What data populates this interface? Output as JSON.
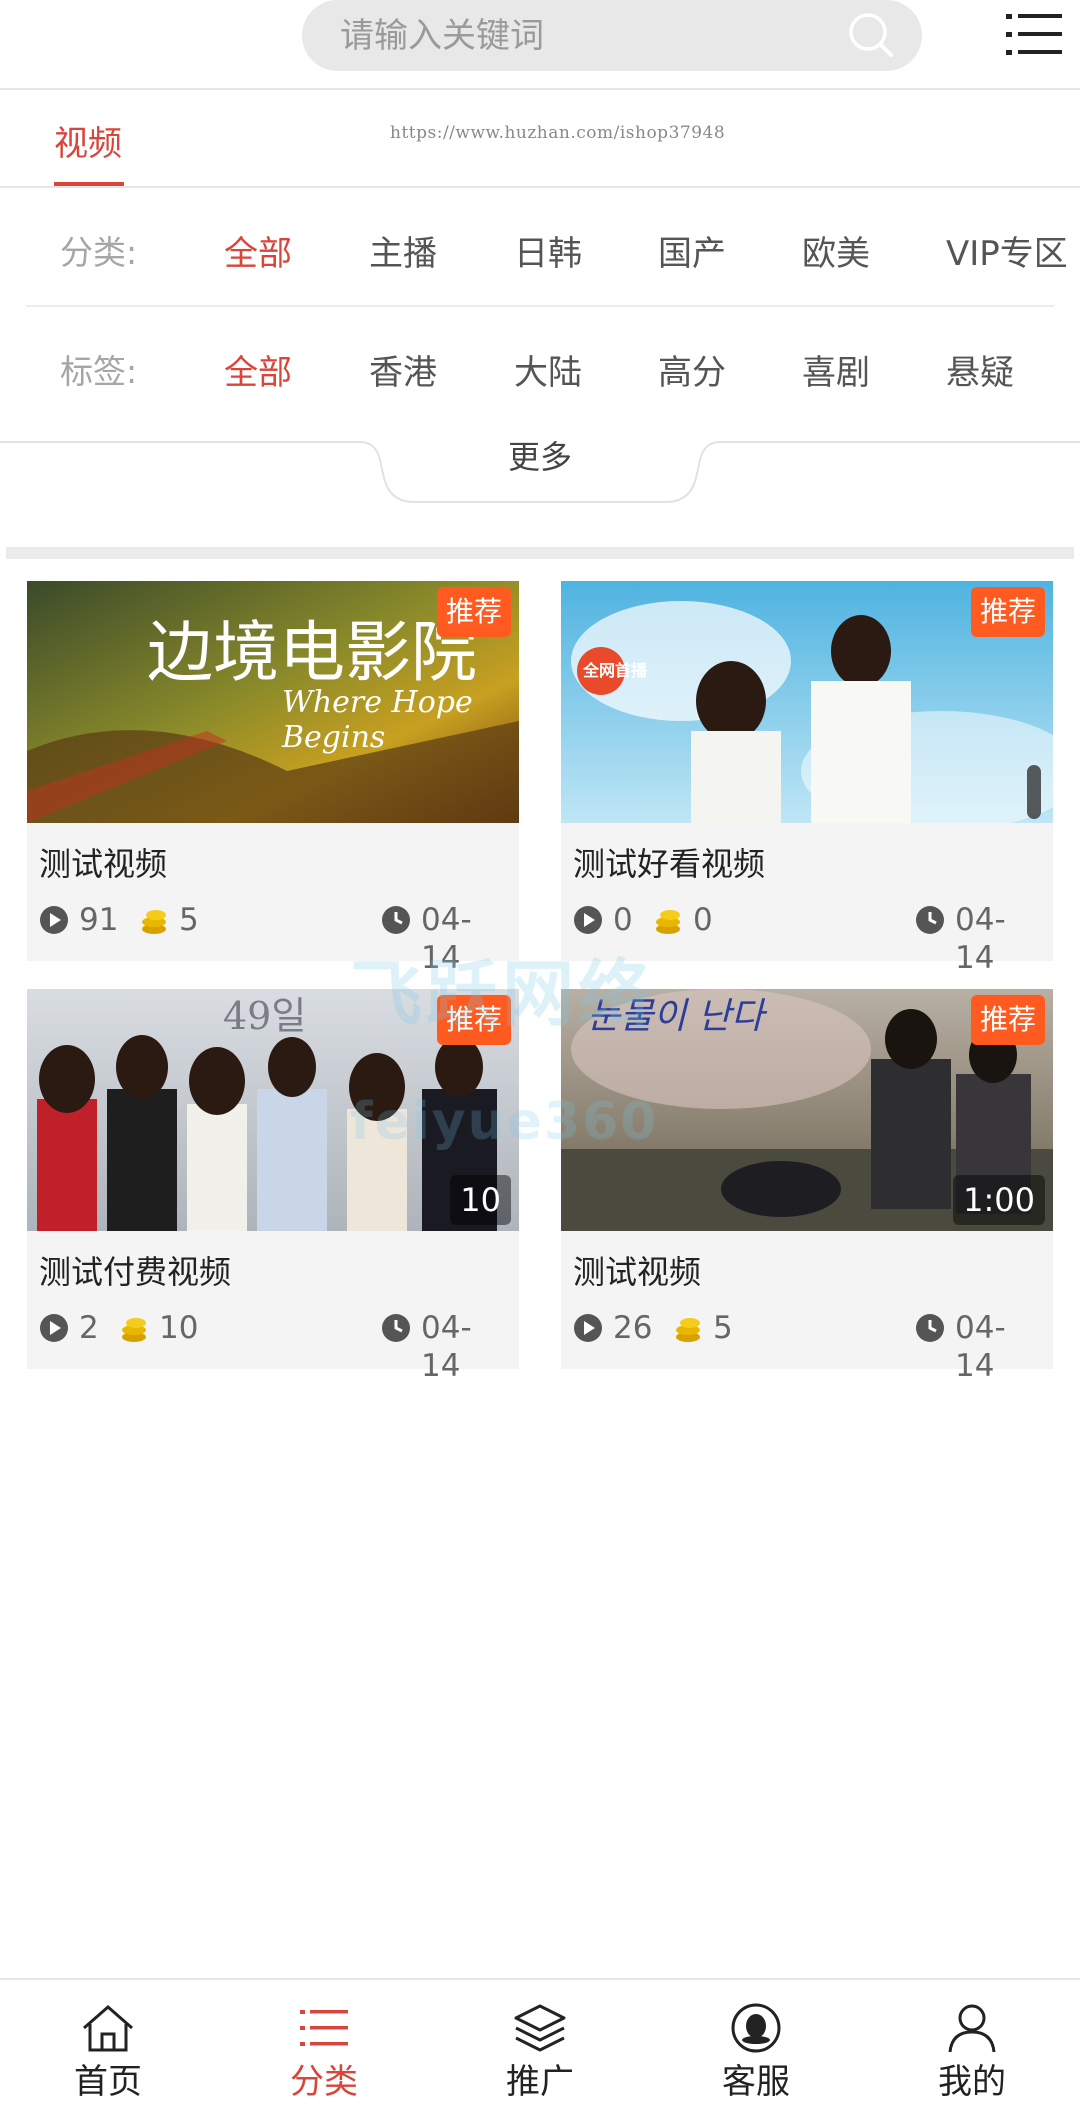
{
  "search": {
    "placeholder": "请输入关键词"
  },
  "tabs": {
    "video": "视频",
    "url": "https://www.huzhan.com/ishop37948"
  },
  "category": {
    "label": "分类:",
    "items": [
      "全部",
      "主播",
      "日韩",
      "国产",
      "欧美",
      "VIP专区"
    ],
    "active": "全部"
  },
  "tags": {
    "label": "标签:",
    "items": [
      "全部",
      "香港",
      "大陆",
      "高分",
      "喜剧",
      "悬疑"
    ],
    "active": "全部"
  },
  "more": "更多",
  "videos": [
    {
      "title": "测试视频",
      "plays": "91",
      "coins": "5",
      "date": "04-14",
      "badge": "推荐",
      "thumb_text": "边境电影院",
      "thumb_sub": "Where Hope Begins"
    },
    {
      "title": "测试好看视频",
      "plays": "0",
      "coins": "0",
      "date": "04-14",
      "badge": "推荐",
      "thumb_text": "全网首播"
    },
    {
      "title": "测试付费视频",
      "plays": "2",
      "coins": "10",
      "date": "04-14",
      "badge": "推荐",
      "duration": "10",
      "thumb_text": "49일"
    },
    {
      "title": "测试视频",
      "plays": "26",
      "coins": "5",
      "date": "04-14",
      "badge": "推荐",
      "duration": "1:00",
      "thumb_text": "눈물이 난다"
    }
  ],
  "watermark": {
    "line1": "飞跃网络",
    "line2": "feiyue360"
  },
  "nav": [
    {
      "label": "首页",
      "icon": "home-icon"
    },
    {
      "label": "分类",
      "icon": "category-list-icon",
      "active": true
    },
    {
      "label": "推广",
      "icon": "layers-icon"
    },
    {
      "label": "客服",
      "icon": "customer-service-icon"
    },
    {
      "label": "我的",
      "icon": "user-icon"
    }
  ],
  "colors": {
    "accent": "#d9453a",
    "badge": "#ff5a1f",
    "search_bg": "#e8e8e8"
  }
}
